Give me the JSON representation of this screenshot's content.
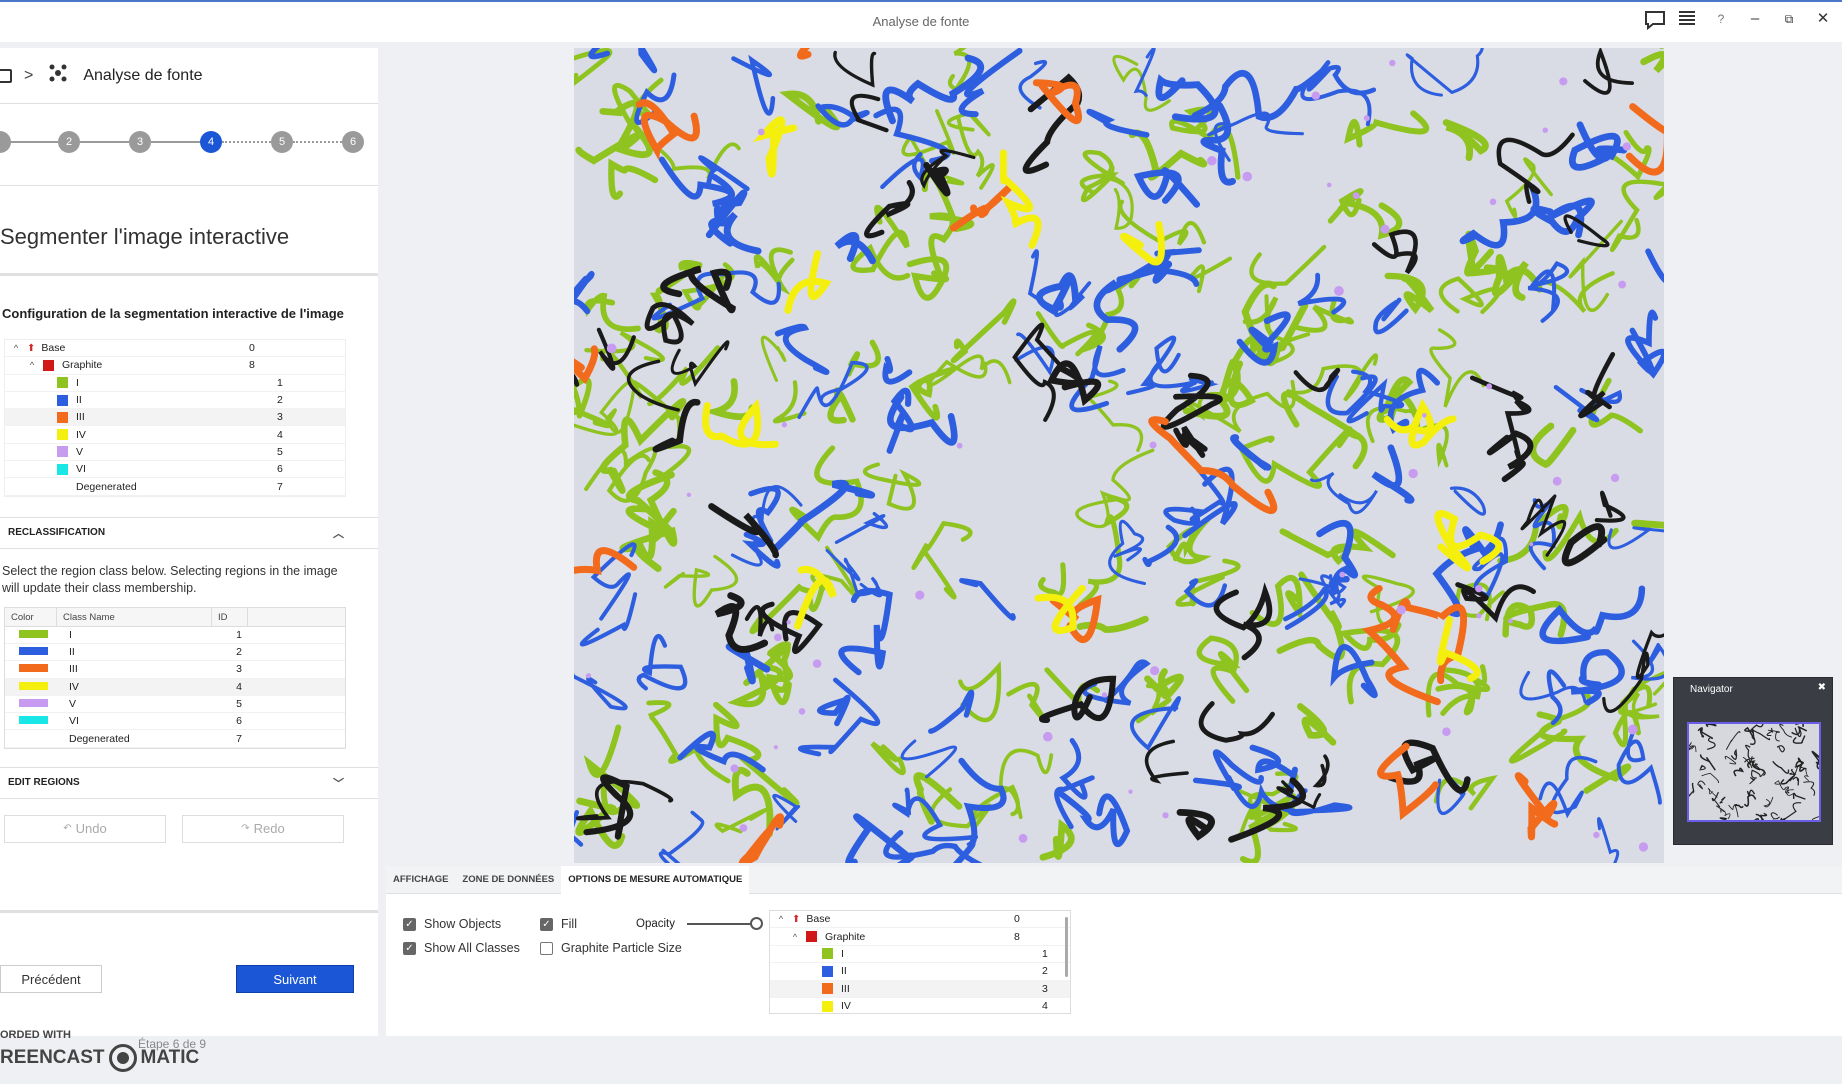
{
  "window": {
    "title": "Analyse de fonte",
    "icons": [
      "chat-icon",
      "menu-icon",
      "help-icon",
      "minimize-icon",
      "restore-icon",
      "close-icon"
    ]
  },
  "breadcrumb": {
    "separator": ">",
    "title": "Analyse de fonte"
  },
  "stepper": {
    "steps": [
      "2",
      "3",
      "4",
      "5",
      "6"
    ],
    "active": "4"
  },
  "section_title": "Segmenter l'image interactive",
  "config_title": "Configuration de la segmentation interactive de l'image",
  "class_tree": [
    {
      "label": "Base",
      "value": "0",
      "level": 0,
      "color": "#d02a2a",
      "icon": "base-icon"
    },
    {
      "label": "Graphite",
      "value": "8",
      "level": 1,
      "color": "#d01818"
    },
    {
      "label": "I",
      "value": "1",
      "level": 2,
      "color": "#8fc31f"
    },
    {
      "label": "II",
      "value": "2",
      "level": 2,
      "color": "#2e5ee0"
    },
    {
      "label": "III",
      "value": "3",
      "level": 2,
      "color": "#f26a1b"
    },
    {
      "label": "IV",
      "value": "4",
      "level": 2,
      "color": "#f5ef0d"
    },
    {
      "label": "V",
      "value": "5",
      "level": 2,
      "color": "#c79bf0"
    },
    {
      "label": "VI",
      "value": "6",
      "level": 2,
      "color": "#19e6e6"
    },
    {
      "label": "Degenerated",
      "value": "7",
      "level": 2,
      "color": ""
    }
  ],
  "reclassification": {
    "title": "RECLASSIFICATION",
    "description": "Select the region class below. Selecting regions in the image will update their class membership.",
    "columns": [
      "Color",
      "Class Name",
      "ID"
    ],
    "rows": [
      {
        "name": "I",
        "id": "1",
        "color": "#8fc31f"
      },
      {
        "name": "II",
        "id": "2",
        "color": "#2e5ee0"
      },
      {
        "name": "III",
        "id": "3",
        "color": "#f26a1b"
      },
      {
        "name": "IV",
        "id": "4",
        "color": "#f5ef0d"
      },
      {
        "name": "V",
        "id": "5",
        "color": "#c79bf0"
      },
      {
        "name": "VI",
        "id": "6",
        "color": "#19e6e6"
      },
      {
        "name": "Degenerated",
        "id": "7",
        "color": ""
      }
    ]
  },
  "edit_regions": {
    "title": "EDIT REGIONS",
    "undo": "Undo",
    "redo": "Redo"
  },
  "navigation": {
    "prev": "Précédent",
    "next": "Suivant",
    "step_info": "Étape 6 de 9"
  },
  "watermark": {
    "line1": "ORDED WITH",
    "line2a": "REENCAST",
    "line2b": "MATIC"
  },
  "navigator": {
    "title": "Navigator"
  },
  "bottom_tabs": [
    "AFFICHAGE",
    "ZONE DE DONNÉES",
    "OPTIONS DE MESURE AUTOMATIQUE"
  ],
  "display_options": {
    "show_objects": "Show Objects",
    "show_all_classes": "Show All Classes",
    "fill": "Fill",
    "particle_size": "Graphite Particle Size",
    "opacity": "Opacity",
    "opacity_value": 1.0
  },
  "mini_tree": [
    {
      "label": "Base",
      "value": "0",
      "level": 0,
      "color": "#d02a2a"
    },
    {
      "label": "Graphite",
      "value": "8",
      "level": 1,
      "color": "#d01818"
    },
    {
      "label": "I",
      "value": "1",
      "level": 2,
      "color": "#8fc31f"
    },
    {
      "label": "II",
      "value": "2",
      "level": 2,
      "color": "#2e5ee0"
    },
    {
      "label": "III",
      "value": "3",
      "level": 2,
      "color": "#f26a1b"
    },
    {
      "label": "IV",
      "value": "4",
      "level": 2,
      "color": "#f5ef0d"
    }
  ]
}
